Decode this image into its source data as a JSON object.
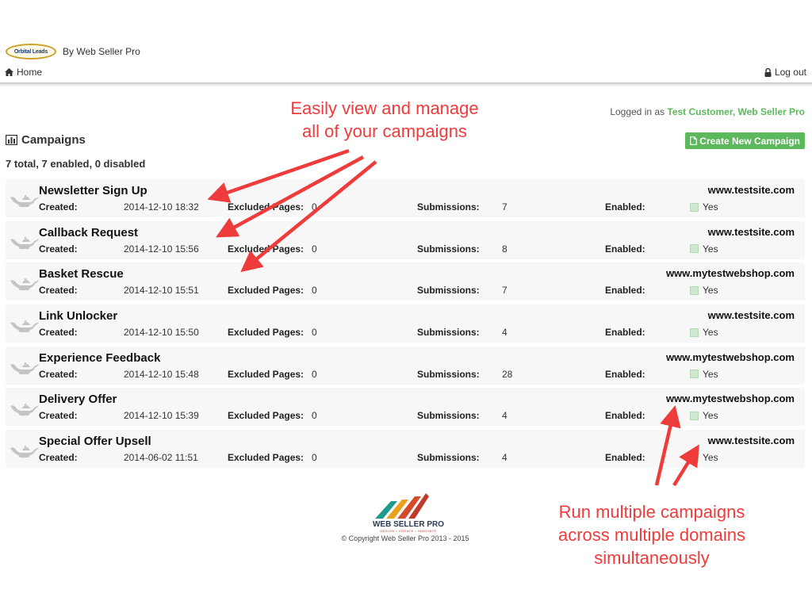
{
  "brand": {
    "logo_text": "Orbital Leads",
    "byline": "By Web Seller Pro"
  },
  "nav": {
    "home_label": "Home",
    "home_icon": "home-icon",
    "logout_label": "Log out",
    "logout_icon": "lock-icon"
  },
  "session": {
    "prefix": "Logged in as",
    "user": "Test Customer, Web Seller Pro"
  },
  "toolbar": {
    "create_label": "Create New Campaign",
    "create_icon": "file-icon",
    "accent": "#5cb85c"
  },
  "campaigns": {
    "title": "Campaigns",
    "title_icon": "bar-chart-icon",
    "summary": "7 total, 7 enabled, 0 disabled",
    "labels": {
      "created": "Created:",
      "excluded": "Excluded Pages:",
      "submissions": "Submissions:",
      "enabled": "Enabled:"
    },
    "rows": [
      {
        "name": "Newsletter Sign Up",
        "domain": "www.testsite.com",
        "created": "2014-12-10 18:32",
        "excluded": "0",
        "submissions": "7",
        "enabled": "Yes"
      },
      {
        "name": "Callback Request",
        "domain": "www.testsite.com",
        "created": "2014-12-10 15:56",
        "excluded": "0",
        "submissions": "8",
        "enabled": "Yes"
      },
      {
        "name": "Basket Rescue",
        "domain": "www.mytestwebshop.com",
        "created": "2014-12-10 15:51",
        "excluded": "0",
        "submissions": "7",
        "enabled": "Yes"
      },
      {
        "name": "Link Unlocker",
        "domain": "www.testsite.com",
        "created": "2014-12-10 15:50",
        "excluded": "0",
        "submissions": "4",
        "enabled": "Yes"
      },
      {
        "name": "Experience Feedback",
        "domain": "www.mytestwebshop.com",
        "created": "2014-12-10 15:48",
        "excluded": "0",
        "submissions": "28",
        "enabled": "Yes"
      },
      {
        "name": "Delivery Offer",
        "domain": "www.mytestwebshop.com",
        "created": "2014-12-10 15:39",
        "excluded": "0",
        "submissions": "4",
        "enabled": "Yes"
      },
      {
        "name": "Special Offer Upsell",
        "domain": "www.testsite.com",
        "created": "2014-06-02 11:51",
        "excluded": "0",
        "submissions": "4",
        "enabled": "Yes"
      }
    ]
  },
  "footer": {
    "logo_name": "WEB SELLER PRO",
    "logo_tagline": "DESIGN • CREATE • INNOVATE",
    "copyright": "© Copyright Web Seller Pro 2013 - 2015"
  },
  "annotations": {
    "top": [
      "Easily view and manage",
      "all of your campaigns"
    ],
    "bottom": [
      "Run multiple campaigns",
      "across multiple domains",
      "simultaneously"
    ],
    "color": "#ee3b3b"
  }
}
